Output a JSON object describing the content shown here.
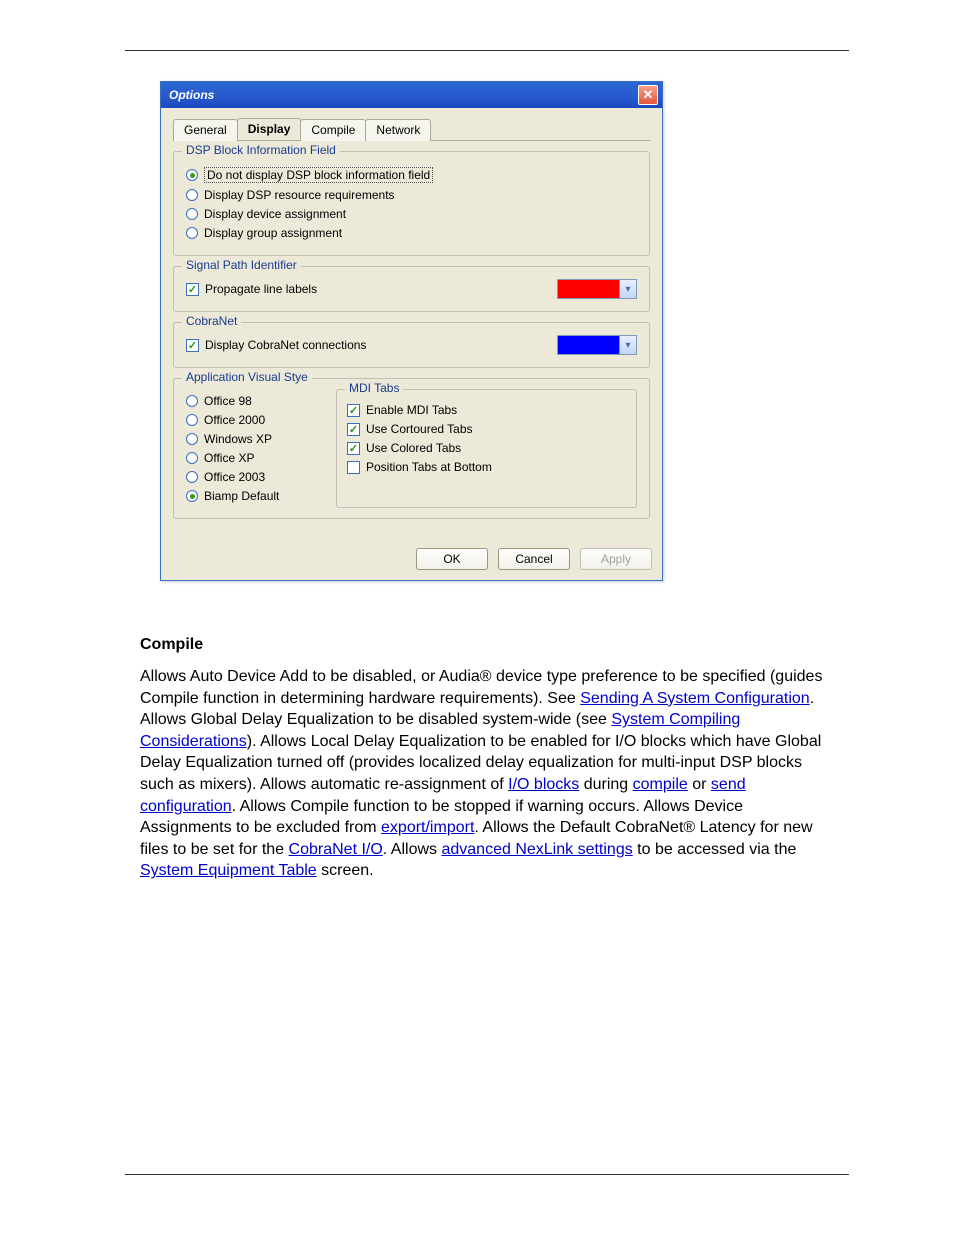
{
  "dialog": {
    "title": "Options",
    "close_label": "✕",
    "tabs": {
      "general": "General",
      "display": "Display",
      "compile": "Compile",
      "network": "Network"
    },
    "dsp_group_legend": "DSP Block Information Field",
    "dsp_r1": "Do not display DSP block information field",
    "dsp_r2": "Display DSP resource requirements",
    "dsp_r3": "Display device assignment",
    "dsp_r4": "Display group assignment",
    "spi_legend": "Signal Path Identifier",
    "spi_ck": "Propagate line labels",
    "cn_legend": "CobraNet",
    "cn_ck": "Display CobraNet connections",
    "avs_legend": "Application Visual Stye",
    "avs_r1": "Office 98",
    "avs_r2": "Office 2000",
    "avs_r3": "Windows XP",
    "avs_r4": "Office XP",
    "avs_r5": "Office 2003",
    "avs_r6": "Biamp Default",
    "mdi_legend": "MDI Tabs",
    "mdi_c1": "Enable MDI Tabs",
    "mdi_c2": "Use Cortoured Tabs",
    "mdi_c3": "Use Colored Tabs",
    "mdi_c4": "Position Tabs at Bottom",
    "ok": "OK",
    "cancel": "Cancel",
    "apply": "Apply"
  },
  "doc": {
    "compile_hdr": "Compile",
    "p1a": "Allows Auto Device Add to be disabled, or ",
    "p1b": "Audia",
    "p1c": "® device type preference to be specified (guides Compile function in determining hardware requirements). See ",
    "link_sending": "Sending A System Configuration",
    "p1d": ". Allows Global Delay Equalization to be disabled system-wide (see ",
    "link_glob": "System Compiling Considerations",
    "p1e": "). Allows Local Delay Equalization to be enabled for I/O blocks which have Global Delay Equalization turned off (provides localized delay equalization for multi-input DSP blocks such as mixers). Allows automatic re-assignment of ",
    "link_unit": "I/O blocks",
    "p1f": " during ",
    "link_cmp": "compile",
    "p1g": " or ",
    "link_send": "send configuration",
    "p1h": ". Allows Compile function to be stopped if warning occurs. Allows Device Assignments to be excluded from ",
    "link_export": "export/import",
    "p1i": ". Allows the Default CobraNet® Latency for new files to be set for the ",
    "link_cnio": "CobraNet I/O",
    "p1j": ". Allows ",
    "link_adv": "advanced NexLink settings",
    "p1k": " to be accessed via the ",
    "link_eqtable": "System Equipment Table",
    "p1l": " screen."
  }
}
